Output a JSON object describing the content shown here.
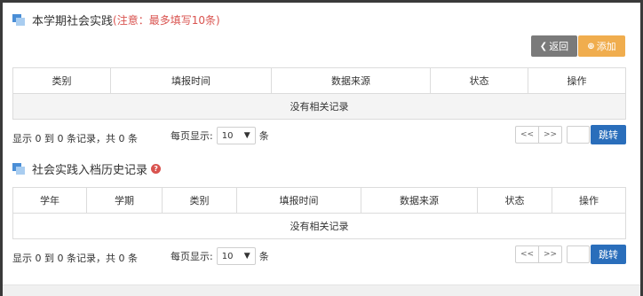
{
  "section1": {
    "title": "本学期社会实践",
    "note": "(注意：最多填写10条)",
    "back_label": "返回",
    "add_label": "添加",
    "columns": [
      "类别",
      "填报时间",
      "数据来源",
      "状态",
      "操作"
    ],
    "empty_text": "没有相关记录",
    "pager": {
      "info": "显示 0 到 0 条记录，共 0 条",
      "per_page_prefix": "每页显示:",
      "per_page_value": "10",
      "per_page_suffix": "条",
      "prev": "<<",
      "next": ">>",
      "jump_label": "跳转"
    }
  },
  "section2": {
    "title": "社会实践入档历史记录",
    "columns": [
      "学年",
      "学期",
      "类别",
      "填报时间",
      "数据来源",
      "状态",
      "操作"
    ],
    "empty_text": "没有相关记录",
    "pager": {
      "info": "显示 0 到 0 条记录，共 0 条",
      "per_page_prefix": "每页显示:",
      "per_page_value": "10",
      "per_page_suffix": "条",
      "prev": "<<",
      "next": ">>",
      "jump_label": "跳转"
    }
  },
  "icons": {
    "section": "cube-icon",
    "back": "chevron-left-icon",
    "add": "plus-circle-icon",
    "help": "question-circle-icon",
    "dropdown": "chevron-down-icon"
  },
  "colors": {
    "note_red": "#d9534f",
    "back_gray": "#7a7a7a",
    "add_orange": "#f0ad4e",
    "jump_blue": "#2a6ebb",
    "icon_blue": "#4a8ed6"
  }
}
